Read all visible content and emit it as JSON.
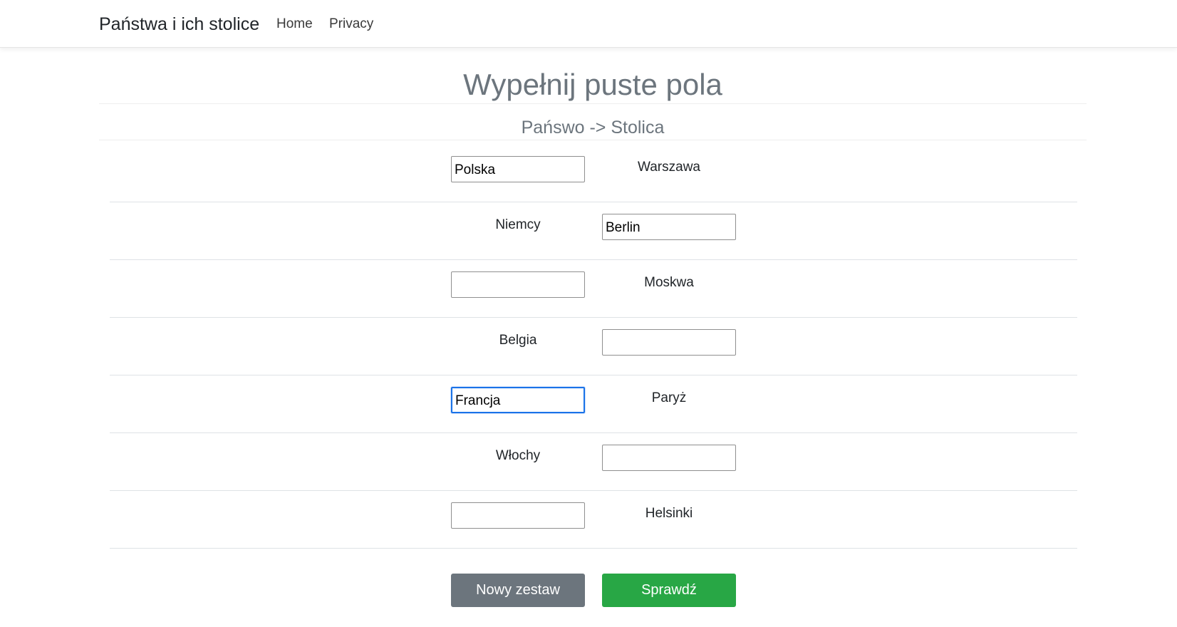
{
  "navbar": {
    "brand": "Państwa i ich stolice",
    "links": [
      "Home",
      "Privacy"
    ]
  },
  "heading": {
    "title": "Wypełnij puste pola",
    "subtitle": "Pańswo -> Stolica"
  },
  "rows": [
    {
      "country": {
        "type": "input",
        "value": "Polska"
      },
      "capital": {
        "type": "text",
        "value": "Warszawa"
      }
    },
    {
      "country": {
        "type": "text",
        "value": "Niemcy"
      },
      "capital": {
        "type": "input",
        "value": "Berlin"
      }
    },
    {
      "country": {
        "type": "input",
        "value": ""
      },
      "capital": {
        "type": "text",
        "value": "Moskwa"
      }
    },
    {
      "country": {
        "type": "text",
        "value": "Belgia"
      },
      "capital": {
        "type": "input",
        "value": ""
      }
    },
    {
      "country": {
        "type": "input",
        "value": "Francja",
        "focused": true
      },
      "capital": {
        "type": "text",
        "value": "Paryż"
      }
    },
    {
      "country": {
        "type": "text",
        "value": "Włochy"
      },
      "capital": {
        "type": "input",
        "value": ""
      }
    },
    {
      "country": {
        "type": "input",
        "value": ""
      },
      "capital": {
        "type": "text",
        "value": "Helsinki"
      }
    }
  ],
  "buttons": {
    "new_set": "Nowy zestaw",
    "check": "Sprawdź"
  },
  "colors": {
    "secondary": "#6c757d",
    "success": "#28a745",
    "focus": "#1a73e8"
  }
}
